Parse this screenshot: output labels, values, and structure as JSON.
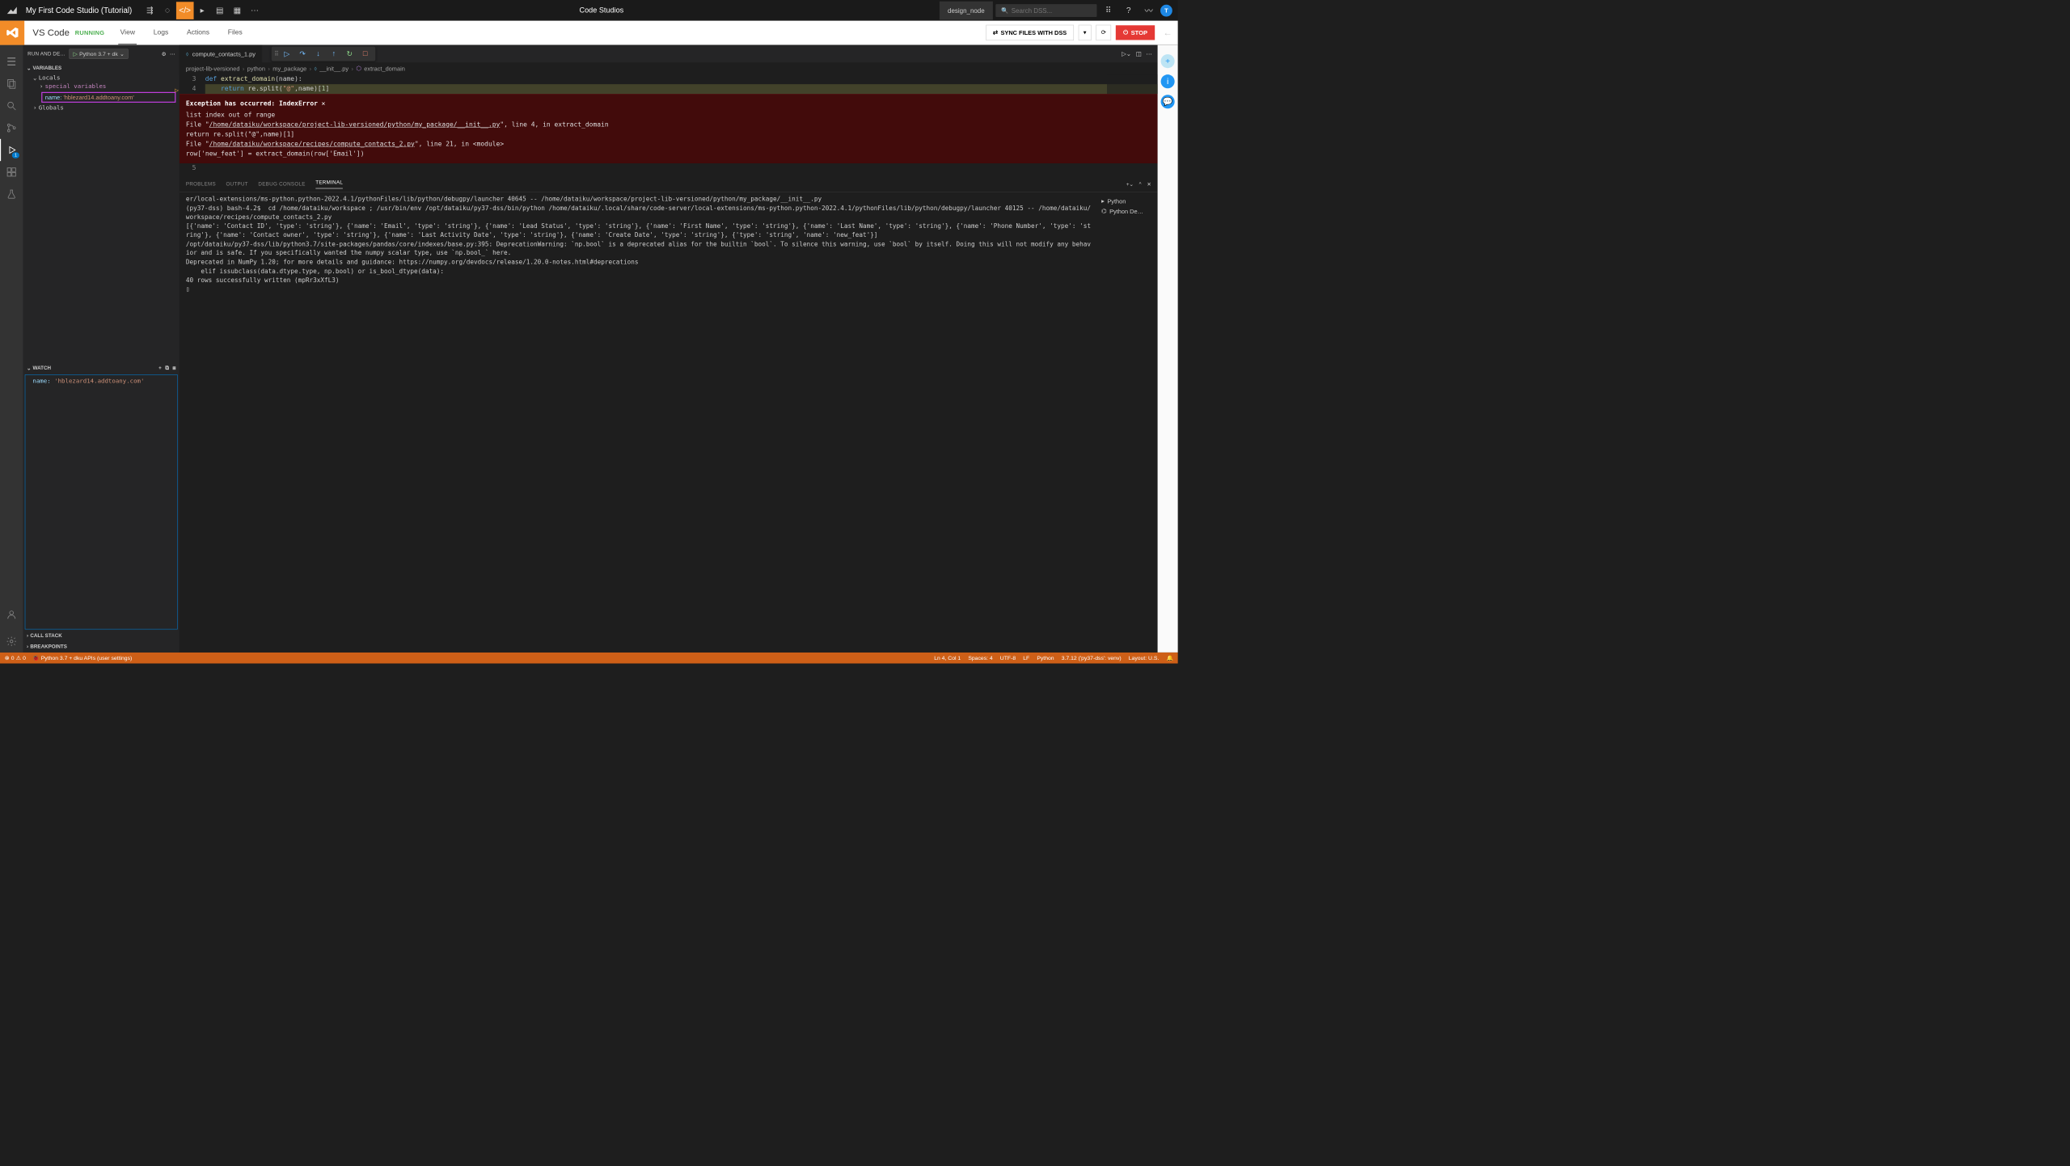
{
  "dss": {
    "title": "My First Code Studio (Tutorial)",
    "center_tab": "Code Studios",
    "node": "design_node",
    "search_placeholder": "Search DSS...",
    "avatar_letter": "T"
  },
  "secondbar": {
    "title": "VS Code",
    "status": "RUNNING",
    "tabs": [
      "View",
      "Logs",
      "Actions",
      "Files"
    ],
    "active_tab": "View",
    "sync_label": "SYNC FILES WITH DSS",
    "stop_label": "STOP"
  },
  "run_panel": {
    "title": "RUN AND DE…",
    "config": "Python 3.7 + dk",
    "sections": {
      "variables": "VARIABLES",
      "locals": "Locals",
      "globals": "Globals",
      "watch": "WATCH",
      "callstack": "CALL STACK",
      "breakpoints": "BREAKPOINTS"
    },
    "special_vars": "special variables",
    "var_name_label": "name:",
    "var_name_value": "'hblezard14.addtoany.com'",
    "watch_name_label": "name:",
    "watch_name_value": "'hblezard14.addtoany.com'"
  },
  "editor": {
    "tab_name": "compute_contacts_1.py",
    "breadcrumbs": [
      "project-lib-versioned",
      "python",
      "my_package",
      "__init__.py",
      "extract_domain"
    ],
    "lines": {
      "3": "def extract_domain(name):",
      "4": "    return re.split(\"@\",name)[1]",
      "5": ""
    }
  },
  "exception": {
    "title": "Exception has occurred: IndexError",
    "message": "list index out of range",
    "trace1_pre": "  File \"",
    "trace1_link": "/home/dataiku/workspace/project-lib-versioned/python/my_package/__init__.py",
    "trace1_post": "\", line 4, in extract_domain",
    "trace1_code": "    return re.split(\"@\",name)[1]",
    "trace2_pre": "  File \"",
    "trace2_link": "/home/dataiku/workspace/recipes/compute_contacts_2.py",
    "trace2_post": "\", line 21, in <module>",
    "trace2_code": "    row['new_feat'] = extract_domain(row['Email'])"
  },
  "panel": {
    "tabs": [
      "PROBLEMS",
      "OUTPUT",
      "DEBUG CONSOLE",
      "TERMINAL"
    ],
    "active": "TERMINAL",
    "side_items": [
      "Python",
      "Python De…"
    ],
    "terminal_text": "er/local-extensions/ms-python.python-2022.4.1/pythonFiles/lib/python/debugpy/launcher 40645 -- /home/dataiku/workspace/project-lib-versioned/python/my_package/__init__.py\n(py37-dss) bash-4.2$  cd /home/dataiku/workspace ; /usr/bin/env /opt/dataiku/py37-dss/bin/python /home/dataiku/.local/share/code-server/local-extensions/ms-python.python-2022.4.1/pythonFiles/lib/python/debugpy/launcher 40125 -- /home/dataiku/workspace/recipes/compute_contacts_2.py\n[{'name': 'Contact ID', 'type': 'string'}, {'name': 'Email', 'type': 'string'}, {'name': 'Lead Status', 'type': 'string'}, {'name': 'First Name', 'type': 'string'}, {'name': 'Last Name', 'type': 'string'}, {'name': 'Phone Number', 'type': 'string'}, {'name': 'Contact owner', 'type': 'string'}, {'name': 'Last Activity Date', 'type': 'string'}, {'name': 'Create Date', 'type': 'string'}, {'type': 'string', 'name': 'new_feat'}]\n/opt/dataiku/py37-dss/lib/python3.7/site-packages/pandas/core/indexes/base.py:395: DeprecationWarning: `np.bool` is a deprecated alias for the builtin `bool`. To silence this warning, use `bool` by itself. Doing this will not modify any behavior and is safe. If you specifically wanted the numpy scalar type, use `np.bool_` here.\nDeprecated in NumPy 1.20; for more details and guidance: https://numpy.org/devdocs/release/1.20.0-notes.html#deprecations\n    elif issubclass(data.dtype.type, np.bool) or is_bool_dtype(data):\n40 rows successfully written (mpRr3xXfL3)\n▯"
  },
  "status": {
    "errors": "0",
    "warnings": "0",
    "config": "Python 3.7 + dku APIs (user settings)",
    "pos": "Ln 4, Col 1",
    "spaces": "Spaces: 4",
    "encoding": "UTF-8",
    "eol": "LF",
    "lang": "Python",
    "interpreter": "3.7.12 ('py37-dss': venv)",
    "layout": "Layout: U.S."
  }
}
